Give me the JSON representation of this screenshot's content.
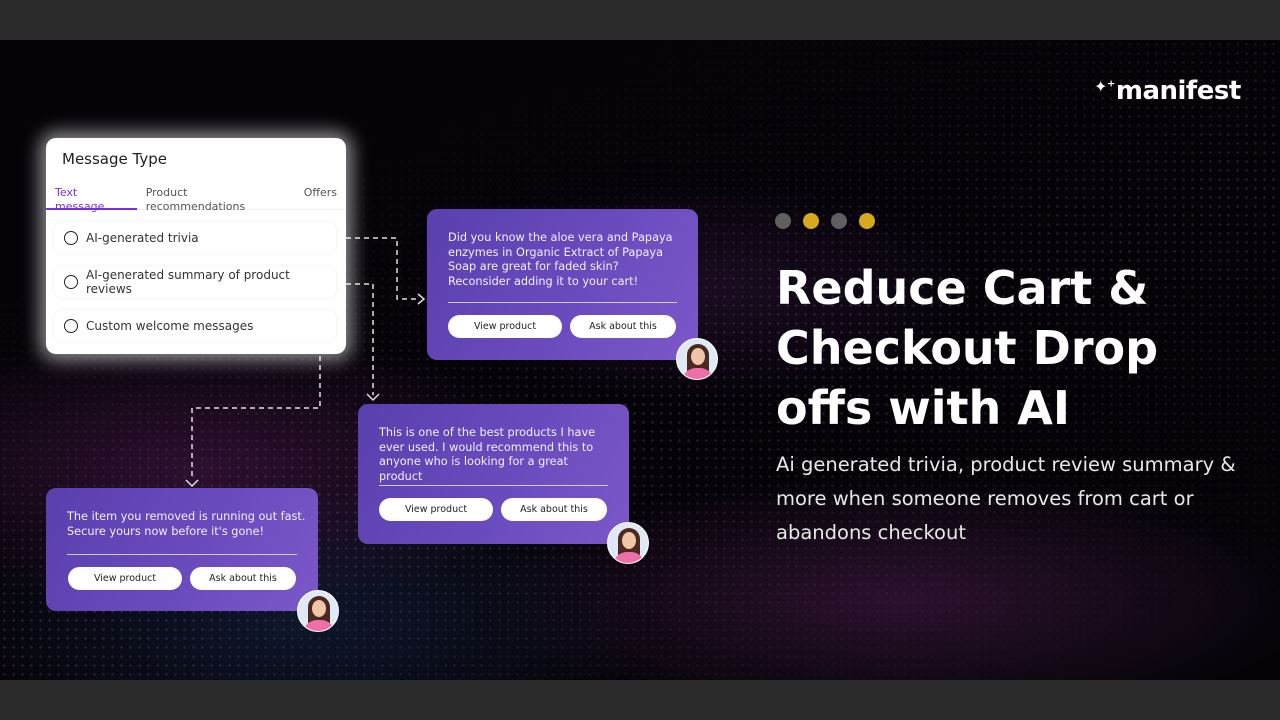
{
  "brand": {
    "logo_text": "manifest",
    "sparkle": "✦⁺"
  },
  "message_type_card": {
    "title": "Message Type",
    "tabs": [
      {
        "label": "Text message",
        "active": true
      },
      {
        "label": "Product recommendations",
        "active": false
      },
      {
        "label": "Offers",
        "active": false
      }
    ],
    "options": [
      {
        "label": "AI-generated trivia",
        "selected": false
      },
      {
        "label": "AI-generated summary of product reviews",
        "selected": false
      },
      {
        "label": "Custom welcome messages",
        "selected": false
      }
    ]
  },
  "messages": [
    {
      "text": "Did you know the aloe vera and Papaya enzymes in Organic Extract of Papaya Soap are great for faded skin? Reconsider adding it to your cart!",
      "view_label": "View product",
      "ask_label": "Ask about this"
    },
    {
      "text": "This is one of the best products I have ever used. I would recommend this to anyone who is looking for a great product",
      "view_label": "View product",
      "ask_label": "Ask about this"
    },
    {
      "text": "The item you removed is running out fast. Secure yours now before it's gone!",
      "view_label": "View product",
      "ask_label": "Ask about this"
    }
  ],
  "pager": {
    "dots": [
      {
        "color": "#5f5f5f"
      },
      {
        "color": "#d6a91e"
      },
      {
        "color": "#5f5f5f"
      },
      {
        "color": "#d6a91e"
      }
    ]
  },
  "hero": {
    "headline": "Reduce Cart & Checkout Drop offs with AI",
    "subtext": "Ai generated trivia, product review summary & more when someone removes from cart or abandons checkout"
  },
  "colors": {
    "accent": "#7b2fd6",
    "card_gradient_start": "#5a3fae",
    "card_gradient_end": "#7b58c9",
    "background": "#050308"
  }
}
